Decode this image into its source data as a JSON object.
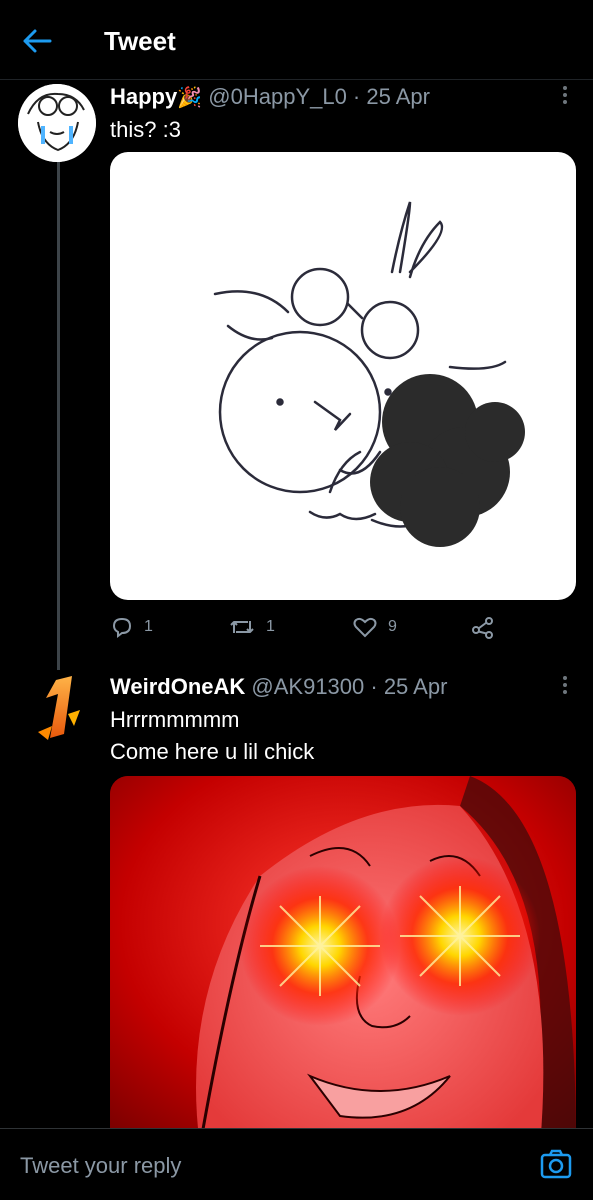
{
  "header": {
    "title": "Tweet"
  },
  "tweets": [
    {
      "name": "Happy",
      "handle": "@0HappY_L0 · 25 Apr",
      "text": "this? :3",
      "actions": {
        "replies": "1",
        "retweets": "1",
        "likes": "9"
      }
    },
    {
      "name": "WeirdOneAK",
      "handle": "@AK91300 · 25 Apr",
      "text_line1": "Hrrrmmmmm",
      "text_line2": "Come here u lil chick"
    }
  ],
  "reply": {
    "placeholder": "Tweet your reply"
  },
  "colors": {
    "accent": "#1d9bf0",
    "background": "#000000",
    "muted": "#8b98a5"
  }
}
